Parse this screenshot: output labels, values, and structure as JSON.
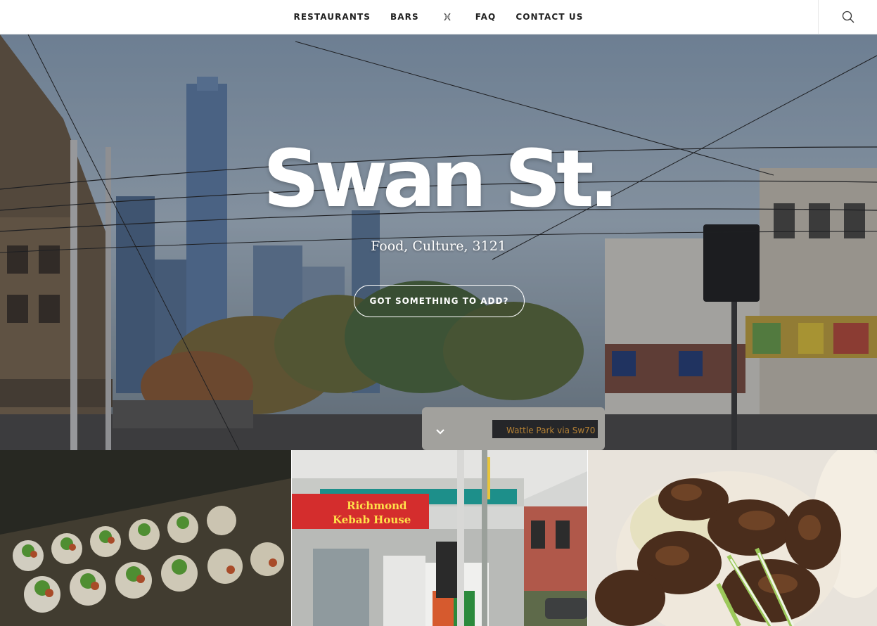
{
  "nav": {
    "items": [
      {
        "label": "RESTAURANTS"
      },
      {
        "label": "BARS"
      },
      {
        "label": "FAQ"
      },
      {
        "label": "CONTACT US"
      }
    ],
    "logo_icon": "swan-logo-icon",
    "search_icon": "search-icon"
  },
  "hero": {
    "title": "Swan St.",
    "subtitle": "Food, Culture, 3121",
    "button_label": "GOT SOMETHING TO ADD?",
    "scroll_icon": "chevron-down-icon"
  },
  "tiles": {
    "kebab_sign_line1": "Richmond",
    "kebab_sign_line2": "Kebab House"
  },
  "colors": {
    "nav_text": "#222222",
    "hero_text": "#ffffff",
    "nav_border": "#e8e8e8"
  }
}
